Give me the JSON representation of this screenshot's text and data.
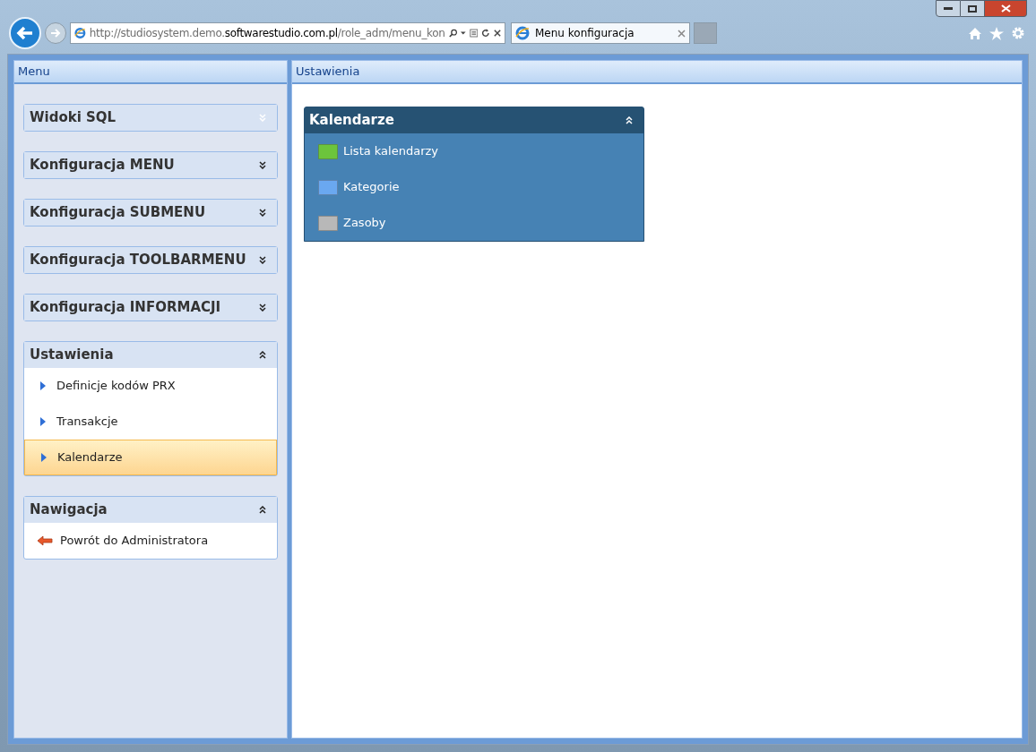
{
  "browser": {
    "url": {
      "prefix": "http://studiosystem.demo.",
      "domain": "softwarestudio.com.pl",
      "path": "/role_adm/menu_kon"
    },
    "tabs": [
      {
        "title": "Menu konfiguracja",
        "selected": true
      }
    ]
  },
  "sidebar": {
    "title": "Menu",
    "sections": [
      {
        "title": "Widoki SQL",
        "expanded": false
      },
      {
        "title": "Konfiguracja MENU",
        "expanded": false
      },
      {
        "title": "Konfiguracja SUBMENU",
        "expanded": false
      },
      {
        "title": "Konfiguracja TOOLBARMENU",
        "expanded": false
      },
      {
        "title": "Konfiguracja INFORMACJI",
        "expanded": false
      },
      {
        "title": "Ustawienia",
        "expanded": true,
        "items": [
          {
            "label": "Definicje kodów PRX",
            "kind": "link",
            "selected": false
          },
          {
            "label": "Transakcje",
            "kind": "link",
            "selected": false
          },
          {
            "label": "Kalendarze",
            "kind": "link",
            "selected": true
          }
        ]
      },
      {
        "title": "Nawigacja",
        "expanded": true,
        "items": [
          {
            "label": "Powrót do Administratora",
            "kind": "back",
            "selected": false
          }
        ]
      }
    ]
  },
  "main": {
    "title": "Ustawienia",
    "panel": {
      "title": "Kalendarze",
      "expanded": true,
      "items": [
        {
          "label": "Lista kalendarzy",
          "color": "#6cc43c"
        },
        {
          "label": "Kategorie",
          "color": "#6aa8f0"
        },
        {
          "label": "Zasoby",
          "color": "#b8b8b8"
        }
      ]
    }
  }
}
